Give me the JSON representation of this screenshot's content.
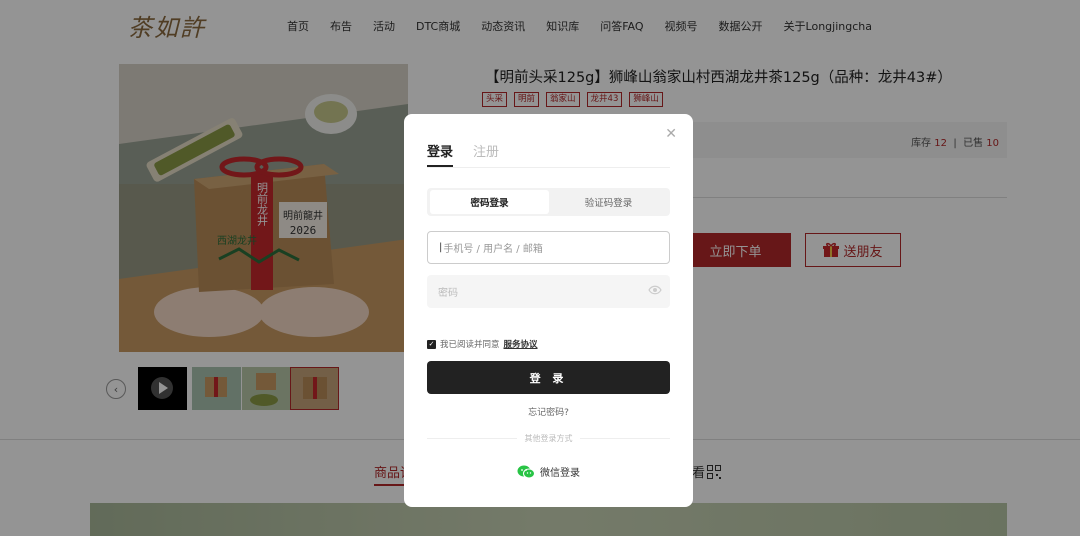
{
  "header": {
    "logo": "茶如許",
    "nav": [
      "首页",
      "布告",
      "活动",
      "DTC商城",
      "动态资讯",
      "知识库",
      "问答FAQ",
      "视频号",
      "数据公开",
      "关于Longjingcha"
    ]
  },
  "product": {
    "title": "【明前头采125g】狮峰山翁家山村西湖龙井茶125g（品种：龙井43#）",
    "tags": [
      "头采",
      "明前",
      "翁家山",
      "龙井43",
      "狮峰山"
    ],
    "stock_label": "库存",
    "stock_value": "12",
    "sold_label": "已售",
    "sold_value": "10",
    "buy_label": "立即下单",
    "gift_label": "送朋友",
    "box_text_1": "明前龙井",
    "box_text_2": "明前龍井",
    "box_year": "2026",
    "box_brand": "西湖龙井"
  },
  "detail_tab": "商品详",
  "qr_tab": "看",
  "modal": {
    "tab_login": "登录",
    "tab_register": "注册",
    "seg_password": "密码登录",
    "seg_code": "验证码登录",
    "user_placeholder": "手机号 / 用户名 / 邮箱",
    "pass_placeholder": "密码",
    "agree_text": "我已阅读并同意",
    "agree_link": "服务协议",
    "login_button": "登 录",
    "forgot": "忘记密码?",
    "other": "其他登录方式",
    "wechat": "微信登录"
  },
  "colors": {
    "accent": "#b1282a",
    "brand_logo": "#8a6a3e",
    "wechat": "#28c445"
  },
  "icons": {
    "close": "close-icon",
    "eye": "eye-icon",
    "wechat": "wechat-icon",
    "gift": "gift-icon",
    "play": "play-icon",
    "qr": "qr-icon"
  }
}
